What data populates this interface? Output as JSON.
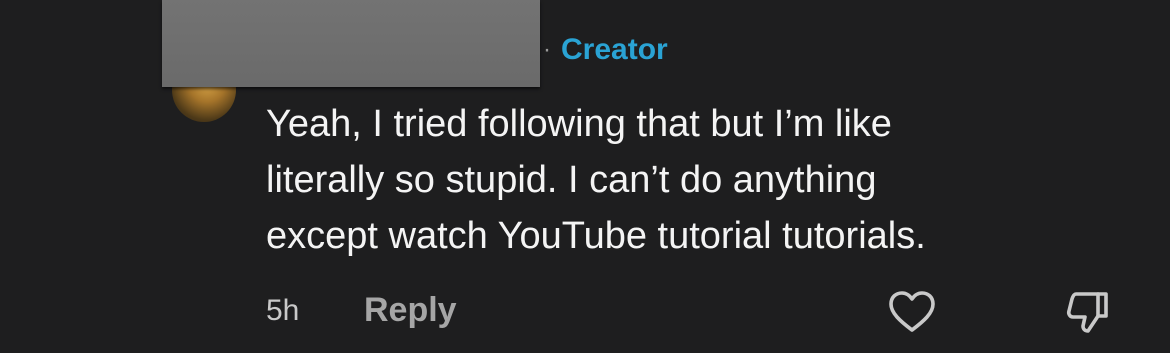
{
  "comment": {
    "badge_separator": "·",
    "badge_label": "Creator",
    "text_lines": [
      "Yeah, I tried following that but I’m like",
      "literally so stupid. I can’t do anything",
      "except watch YouTube tutorial tutorials."
    ],
    "timestamp": "5h",
    "reply_label": "Reply",
    "like_icon": "heart-icon",
    "dislike_icon": "thumbs-down-icon"
  },
  "colors": {
    "background": "#1e1e1f",
    "creator_badge": "#2aa3d4",
    "text": "#f4f4f4",
    "muted": "#a6a6a6"
  }
}
